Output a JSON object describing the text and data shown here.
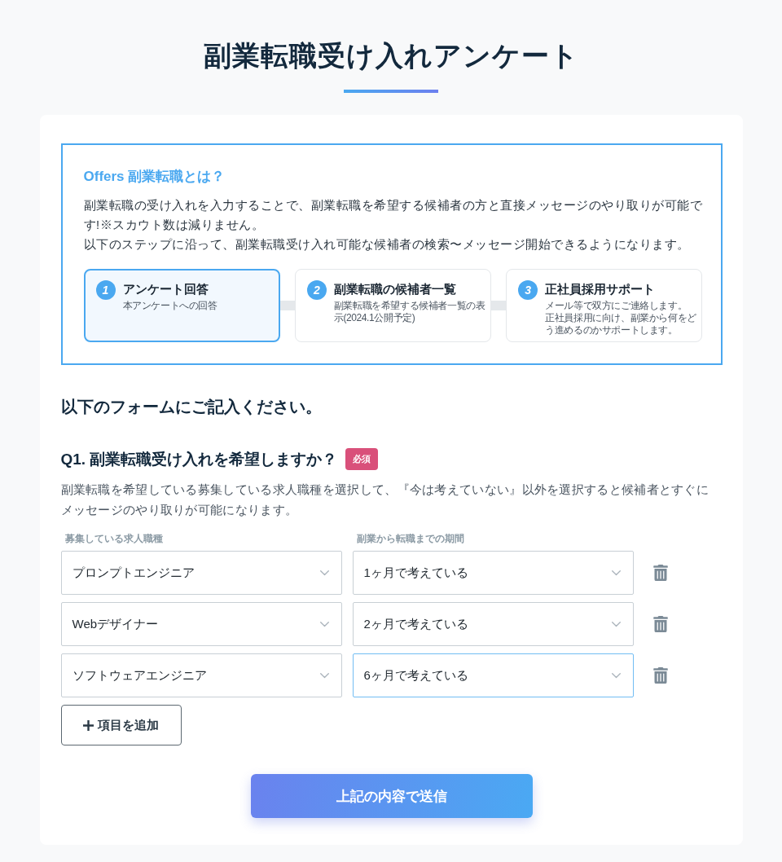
{
  "page": {
    "title": "副業転職受け入れアンケート"
  },
  "intro": {
    "heading": "Offers 副業転職とは？",
    "paragraphs": [
      "副業転職の受け入れを入力することで、副業転職を希望する候補者の方と直接メッセージのやり取りが可能です!※スカウト数は減りません。",
      "以下のステップに沿って、副業転職受け入れ可能な候補者の検索〜メッセージ開始できるようになります。"
    ],
    "steps": [
      {
        "number": "1",
        "title": "アンケート回答",
        "description": [
          "本アンケートへの回答"
        ],
        "selected": true
      },
      {
        "number": "2",
        "title": "副業転職の候補者一覧",
        "description": [
          "副業転職を希望する候補者一覧の表示(2024.1公開予定)"
        ],
        "selected": false
      },
      {
        "number": "3",
        "title": "正社員採用サポート",
        "description": [
          "メール等で双方にご連絡します。",
          "正社員採用に向け、副業から何をどう進めるのかサポートします。"
        ],
        "selected": false
      }
    ]
  },
  "form": {
    "heading": "以下のフォームにご記入ください。",
    "question": {
      "title": "Q1. 副業転職受け入れを希望しますか？",
      "badge": "必須",
      "description": "副業転職を希望している募集している求人職種を選択して、『今は考えていない』以外を選択すると候補者とすぐにメッセージのやり取りが可能になります。",
      "columns": [
        "募集している求人職種",
        "副業から転職までの期間"
      ],
      "rows": [
        {
          "job": {
            "value": "プロンプトエンジニア",
            "focused": false
          },
          "period": {
            "value": "1ヶ月で考えている",
            "focused": false
          }
        },
        {
          "job": {
            "value": "Webデザイナー",
            "focused": false
          },
          "period": {
            "value": "2ヶ月で考えている",
            "focused": false
          }
        },
        {
          "job": {
            "value": "ソフトウェアエンジニア",
            "focused": false
          },
          "period": {
            "value": "6ヶ月で考えている",
            "focused": true
          }
        }
      ],
      "add_button": "項目を追加"
    },
    "submit_button": "上記の内容で送信"
  }
}
